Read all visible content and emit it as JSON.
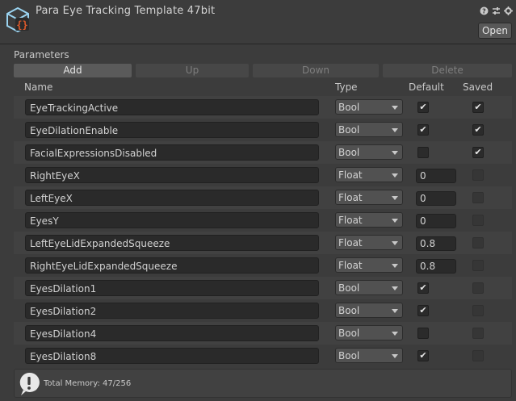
{
  "header": {
    "title": "Para Eye Tracking Template 47bit",
    "open_label": "Open",
    "icons": [
      "help-icon",
      "presets-icon",
      "gear-icon"
    ]
  },
  "parameters": {
    "label": "Parameters",
    "buttons": [
      "Add",
      "Up",
      "Down",
      "Delete"
    ],
    "columns": {
      "name": "Name",
      "type": "Type",
      "default": "Default",
      "saved": "Saved"
    },
    "rows": [
      {
        "name": "EyeTrackingActive",
        "type": "Bool",
        "default": true,
        "saved": true
      },
      {
        "name": "EyeDilationEnable",
        "type": "Bool",
        "default": true,
        "saved": true
      },
      {
        "name": "FacialExpressionsDisabled",
        "type": "Bool",
        "default": false,
        "saved": true
      },
      {
        "name": "RightEyeX",
        "type": "Float",
        "default": "0",
        "saved": false
      },
      {
        "name": "LeftEyeX",
        "type": "Float",
        "default": "0",
        "saved": false
      },
      {
        "name": "EyesY",
        "type": "Float",
        "default": "0",
        "saved": false
      },
      {
        "name": "LeftEyeLidExpandedSqueeze",
        "type": "Float",
        "default": "0.8",
        "saved": false
      },
      {
        "name": "RightEyeLidExpandedSqueeze",
        "type": "Float",
        "default": "0.8",
        "saved": false
      },
      {
        "name": "EyesDilation1",
        "type": "Bool",
        "default": true,
        "saved": false
      },
      {
        "name": "EyesDilation2",
        "type": "Bool",
        "default": true,
        "saved": false
      },
      {
        "name": "EyesDilation4",
        "type": "Bool",
        "default": false,
        "saved": false
      },
      {
        "name": "EyesDilation8",
        "type": "Bool",
        "default": true,
        "saved": false
      }
    ]
  },
  "footer": {
    "memory_text": "Total Memory: 47/256",
    "icon": "warning-icon"
  },
  "colors": {
    "background": "#3c3c3c",
    "asset_icon_accent": "#e05a2b",
    "asset_icon_outline": "#9ad3f0"
  }
}
